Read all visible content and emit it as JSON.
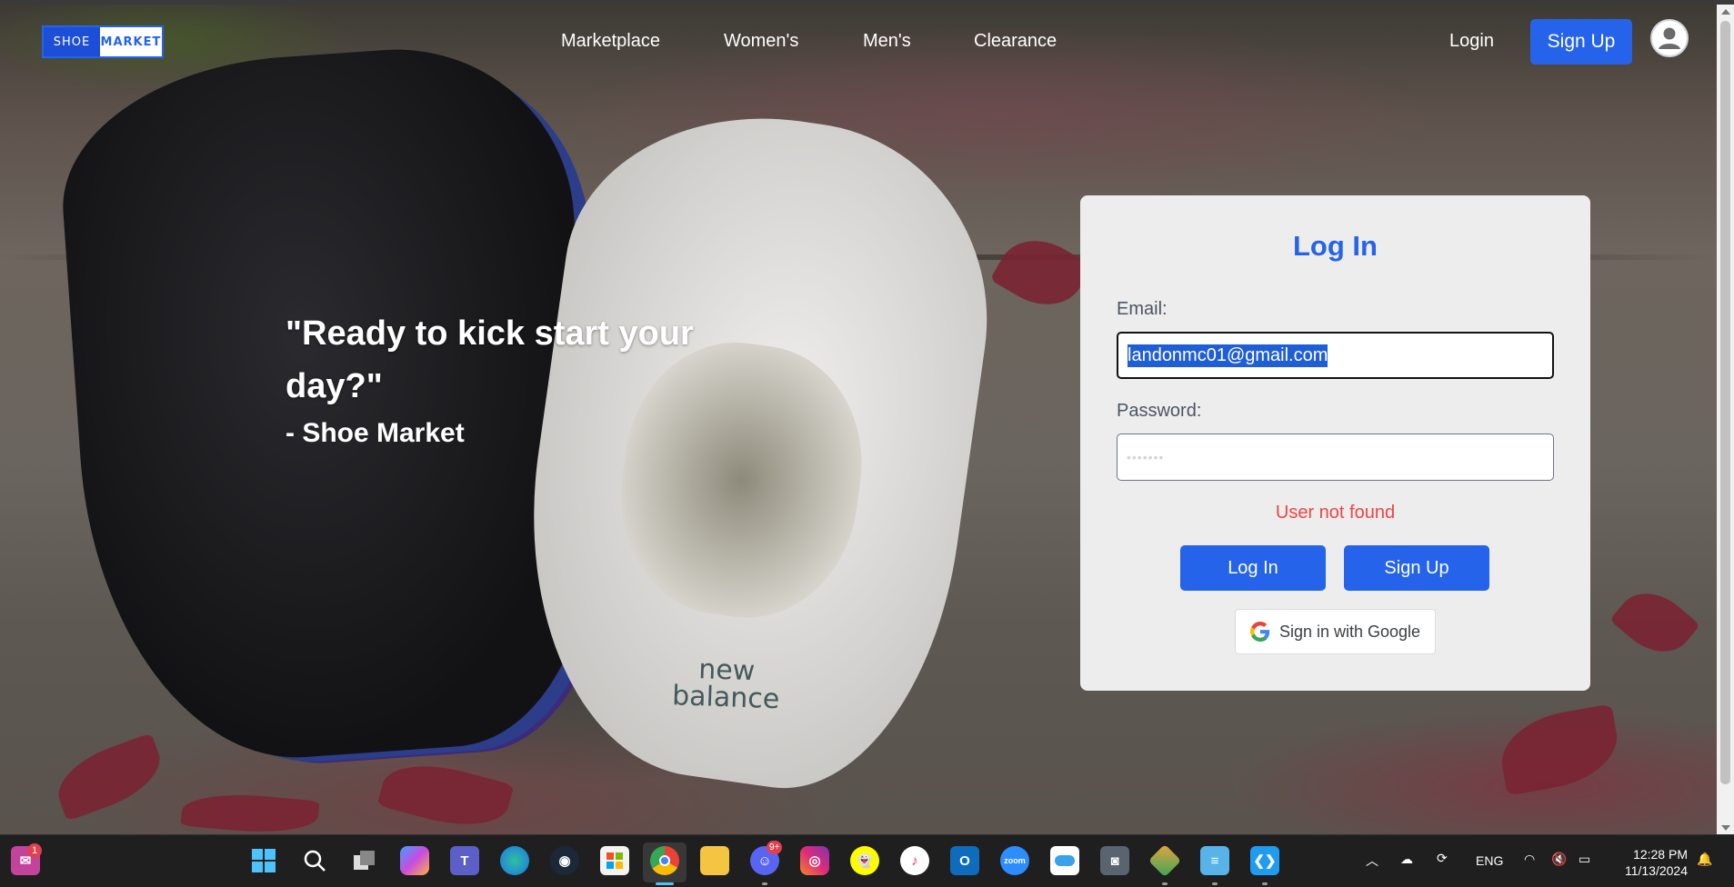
{
  "app": {
    "logo_left": "SHOE",
    "logo_right": "MARKET"
  },
  "nav": {
    "links": [
      "Marketplace",
      "Women's",
      "Men's",
      "Clearance"
    ],
    "login": "Login",
    "signup": "Sign Up"
  },
  "hero": {
    "quote": "\"Ready to kick start your day?\"",
    "attribution": "- Shoe Market",
    "shoe_brand": "new balance"
  },
  "login_form": {
    "title": "Log In",
    "email_label": "Email:",
    "email_value": "landonmc01@gmail.com",
    "password_label": "Password:",
    "password_value": "•••••••",
    "error": "User not found",
    "login_button": "Log In",
    "signup_button": "Sign Up",
    "google_button": "Sign in with Google"
  },
  "taskbar": {
    "notification_badge": "1",
    "discord_badge": "9+",
    "lang": "ENG",
    "time": "12:28 PM",
    "date": "11/13/2024",
    "icons": [
      "start-icon",
      "search-icon",
      "task-view-icon",
      "copilot-icon",
      "teams-icon",
      "edge-icon",
      "steam-icon",
      "store-icon",
      "chrome-icon",
      "file-explorer-icon",
      "discord-icon",
      "instagram-icon",
      "snapchat-icon",
      "itunes-icon",
      "outlook-icon",
      "zoom-icon",
      "onedrive-icon",
      "camera-icon",
      "git-icon",
      "notepad-icon",
      "vscode-icon"
    ]
  },
  "colors": {
    "accent": "#2563eb",
    "error": "#ef4444",
    "card_bg": "#ededed"
  }
}
